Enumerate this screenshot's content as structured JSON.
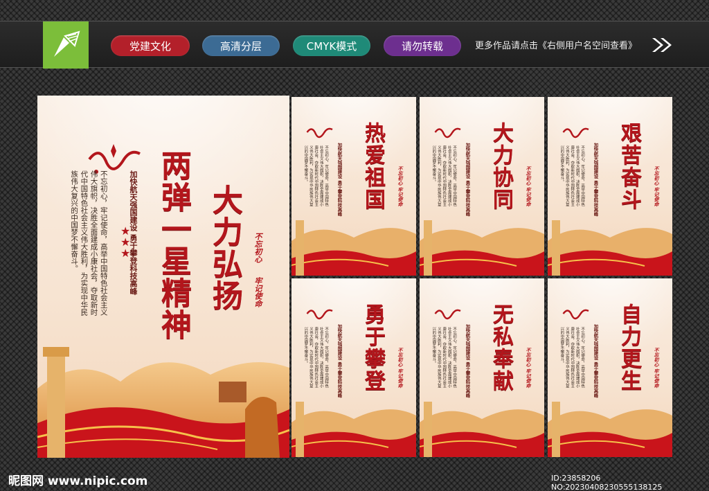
{
  "topbar": {
    "tags": [
      "党建文化",
      "高清分层",
      "CMYK模式",
      "请勿转载"
    ],
    "note": "更多作品请点击《右侧用户名空间查看》"
  },
  "main_poster": {
    "title_a": "大力弘扬",
    "title_b": "两弹一星精神",
    "subtitle": "加快航天强国建设 勇于攀登科技高峰",
    "body": "不忘初心，牢记使命，高举中国特色社会主义伟大旗帜，决胜全面建成小康社会，夺取新时代中国特色社会主义伟大胜利，为实现中华民族伟大复兴的中国梦不懈奋斗。",
    "seal_1": "不忘初心",
    "seal_2": "牢记使命"
  },
  "small_posters": [
    {
      "title": "热爱祖国"
    },
    {
      "title": "大力协同"
    },
    {
      "title": "艰苦奋斗"
    },
    {
      "title": "勇于攀登"
    },
    {
      "title": "无私奉献"
    },
    {
      "title": "自力更生"
    }
  ],
  "small_common": {
    "subtitle": "加快航天强国建设 勇于攀登科技高峰",
    "body": "不忘初心，牢记使命，高举中国特色社会主义伟大旗帜，决胜全面建成小康社会，夺取新时代中国特色社会主义伟大胜利，为实现中华民族伟大复兴的中国梦不懈奋斗。",
    "seal": "不忘初心 牢记使命"
  },
  "footer": {
    "site": "昵图网 www.nipic.com",
    "id": "ID:23858206 NO:20230408230555138125"
  },
  "colors": {
    "party_red": "#b3161c",
    "logo_green": "#7cbe3a"
  }
}
